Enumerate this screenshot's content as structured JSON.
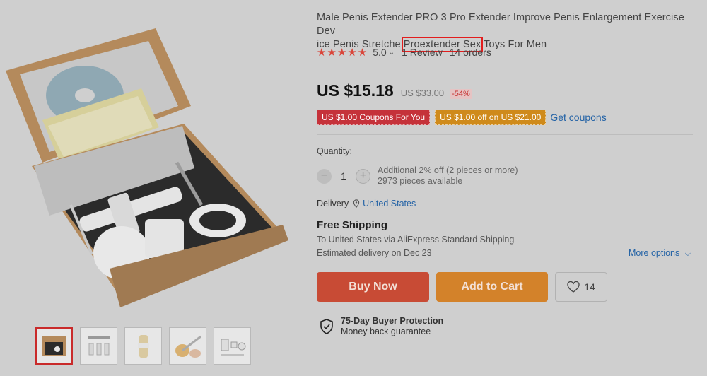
{
  "product": {
    "title_before": "Male Penis Extender PRO 3 Pro Extender Improve Penis Enlargement Exercise Dev",
    "title_line2_start": "ice Penis Stretche ",
    "title_highlight": "Proextender Sex",
    "title_after": " Toys For Men"
  },
  "rating": {
    "stars": "★★★★★",
    "score": "5.0",
    "reviews": "1 Review",
    "orders": "14 orders"
  },
  "price": {
    "current": "US $15.18",
    "original": "US $33.00",
    "discount": "-54%"
  },
  "coupons": {
    "coupon1": "US $1.00 Coupons For You",
    "coupon2": "US $1.00 off on US $21.00",
    "get_coupons": "Get coupons"
  },
  "quantity": {
    "label": "Quantity:",
    "value": "1",
    "additional": "Additional 2% off (2 pieces or more)",
    "available": "2973 pieces available"
  },
  "delivery": {
    "label": "Delivery",
    "location": "United States",
    "free_shipping": "Free Shipping",
    "via": "To United States via AliExpress Standard Shipping",
    "estimated": "Estimated delivery on Dec 23",
    "more_options": "More options"
  },
  "actions": {
    "buy_now": "Buy Now",
    "add_to_cart": "Add to Cart",
    "wishlist_count": "14"
  },
  "protection": {
    "title": "75-Day Buyer Protection",
    "subtitle": "Money back guarantee"
  },
  "colors": {
    "star": "#d9453a",
    "buy_now": "#c84b35",
    "add_to_cart": "#d3822a",
    "link": "#2463a6"
  }
}
